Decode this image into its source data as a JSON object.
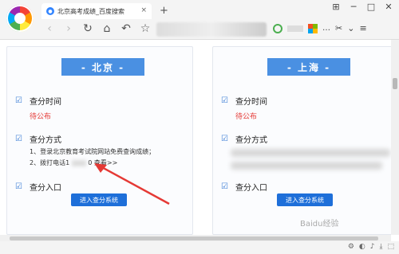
{
  "browser": {
    "tab_title": "北京高考成绩_百度搜索",
    "tab_favicon": "baidu-paw-icon",
    "tab_close": "×",
    "new_tab": "+",
    "window_buttons": [
      "⊞",
      "─",
      "□",
      "✕"
    ],
    "nav_icons": [
      "‹",
      "›",
      "↻",
      "⌂",
      "↶",
      "☆"
    ],
    "right_icons": [
      "…"
    ]
  },
  "panels": [
    {
      "city": "- 北京 -",
      "sections": [
        {
          "title": "查分时间",
          "detail": "待公布"
        },
        {
          "title": "查分方式",
          "steps": [
            "1、登录北京教育考试院网站免费查询成绩；",
            "2、拨打电话1",
            "0 查看>>"
          ]
        },
        {
          "title": "查分入口",
          "button": "进入查分系统"
        }
      ]
    },
    {
      "city": "- 上海 -",
      "sections": [
        {
          "title": "查分时间",
          "detail": "待公布"
        },
        {
          "title": "查分方式"
        },
        {
          "title": "查分入口",
          "button": "进入查分系统"
        }
      ]
    }
  ],
  "check_glyph": "☑",
  "watermark": "Baidu经验",
  "status_icons": [
    "⚙",
    "◐",
    "♪",
    "⤓",
    "⬚"
  ],
  "colors": {
    "accent": "#4a90e2",
    "button": "#1e6fd9",
    "pending": "#e53935",
    "arrow": "#e53935"
  }
}
